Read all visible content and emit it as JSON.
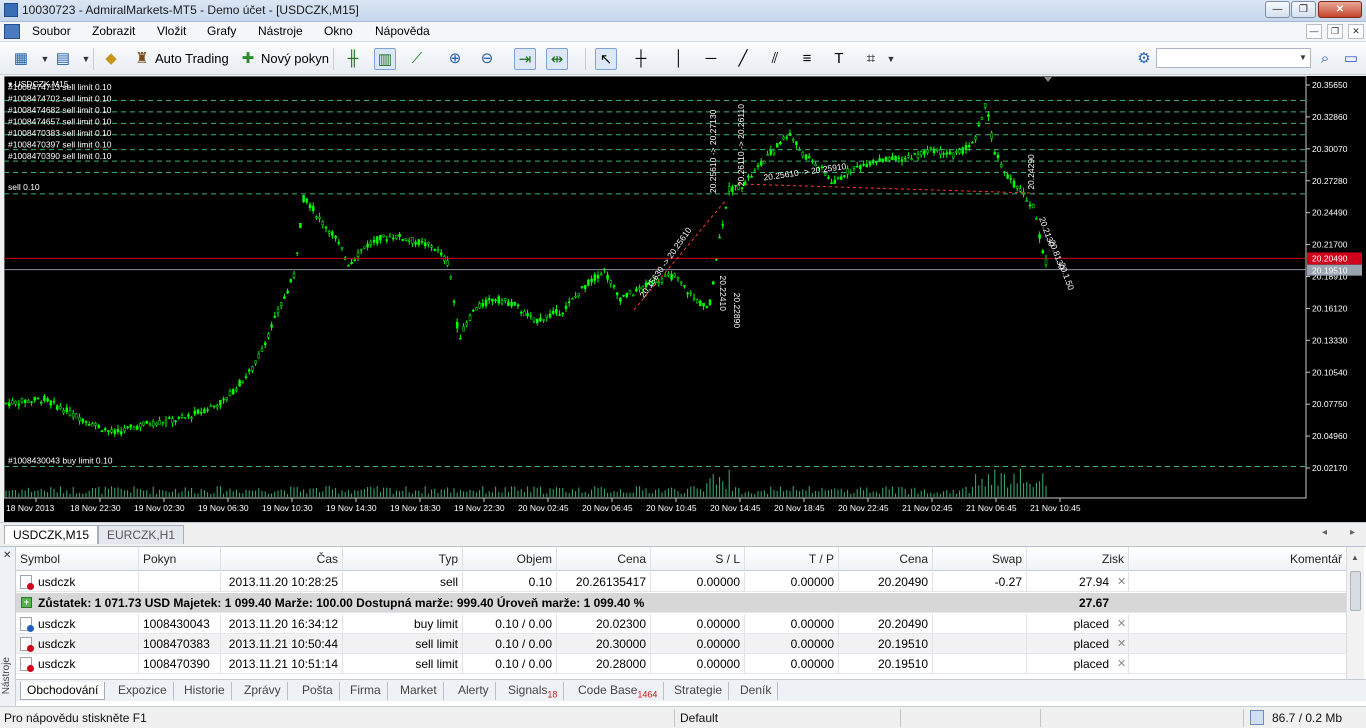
{
  "window": {
    "title": "10030723 - AdmiralMarkets-MT5 - Demo účet - [USDCZK,M15]",
    "min": "—",
    "max": "❐",
    "close": "✕"
  },
  "menu": {
    "items": [
      "Soubor",
      "Zobrazit",
      "Vložit",
      "Grafy",
      "Nástroje",
      "Okno",
      "Nápověda"
    ],
    "mdi_min": "—",
    "mdi_restore": "❐",
    "mdi_close": "✕"
  },
  "toolbar": {
    "auto_trading": "Auto Trading",
    "new_order": "Nový pokyn",
    "search_value": ""
  },
  "chart": {
    "symbol": "USDCZK,M15",
    "price_axis": [
      "20.35650",
      "20.32860",
      "20.30070",
      "20.27280",
      "20.24490",
      "20.21700",
      "20.18910",
      "20.16120",
      "20.13330",
      "20.10540",
      "20.07750",
      "20.04960",
      "20.02170"
    ],
    "time_axis": [
      "18 Nov 2013",
      "18 Nov 22:30",
      "19 Nov 02:30",
      "19 Nov 06:30",
      "19 Nov 10:30",
      "19 Nov 14:30",
      "19 Nov 18:30",
      "19 Nov 22:30",
      "20 Nov 02:45",
      "20 Nov 06:45",
      "20 Nov 10:45",
      "20 Nov 14:45",
      "20 Nov 18:45",
      "20 Nov 22:45",
      "21 Nov 02:45",
      "21 Nov 06:45",
      "21 Nov 10:45"
    ],
    "current_bid": "20.20490",
    "current_ask": "20.19510",
    "bid_color": "#d0021b",
    "ask_color": "#8b95a1",
    "order_lines": [
      {
        "label": "#1008474713 sell limit 0.10"
      },
      {
        "label": "#1008474702 sell limit 0.10"
      },
      {
        "label": "#1008474682 sell limit 0.10"
      },
      {
        "label": "#1008474657 sell limit 0.10"
      },
      {
        "label": "#1008470383 sell limit 0.10"
      },
      {
        "label": "#1008470397 sell limit 0.10"
      },
      {
        "label": "#1008470390 sell limit 0.10"
      },
      {
        "label": "sell 0.10"
      },
      {
        "label": "#1008430043 buy limit 0.10"
      }
    ],
    "annotations": [
      "20.15630 -> 20.25610",
      "20.25610 -> 20.27130",
      "20.22410",
      "20.22890",
      "20.26110 -> 20.26110",
      "20.24290",
      "20.25610 -> 20.25910",
      "20.2130",
      "20.8130",
      "20.1.50"
    ],
    "candle_color": "#00ff00",
    "line_color": "#3cb371"
  },
  "chart_tabs": [
    "USDCZK,M15",
    "EURCZK,H1"
  ],
  "toolbox": {
    "side_label": "Nástroje",
    "columns": [
      "Symbol",
      "Pokyn",
      "Čas",
      "Typ",
      "Objem",
      "Cena",
      "S / L",
      "T / P",
      "Cena",
      "Swap",
      "Zisk",
      "Komentář"
    ],
    "positions": [
      {
        "symbol": "usdczk",
        "order": "",
        "time": "2013.11.20 10:28:25",
        "type": "sell",
        "volume": "0.10",
        "price": "20.26135417",
        "sl": "0.00000",
        "tp": "0.00000",
        "cur": "20.20490",
        "swap": "-0.27",
        "profit": "27.94",
        "comment": ""
      }
    ],
    "balance_line": "Zůstatek: 1 071.73 USD  Majetek: 1 099.40  Marže: 100.00  Dostupná marže: 999.40  Úroveň marže: 1 099.40 %",
    "balance_profit": "27.67",
    "orders": [
      {
        "symbol": "usdczk",
        "order": "1008430043",
        "time": "2013.11.20 16:34:12",
        "type": "buy limit",
        "volume": "0.10 / 0.00",
        "price": "20.02300",
        "sl": "0.00000",
        "tp": "0.00000",
        "cur": "20.20490",
        "swap": "",
        "profit": "placed",
        "comment": ""
      },
      {
        "symbol": "usdczk",
        "order": "1008470383",
        "time": "2013.11.21 10:50:44",
        "type": "sell limit",
        "volume": "0.10 / 0.00",
        "price": "20.30000",
        "sl": "0.00000",
        "tp": "0.00000",
        "cur": "20.19510",
        "swap": "",
        "profit": "placed",
        "comment": ""
      },
      {
        "symbol": "usdczk",
        "order": "1008470390",
        "time": "2013.11.21 10:51:14",
        "type": "sell limit",
        "volume": "0.10 / 0.00",
        "price": "20.28000",
        "sl": "0.00000",
        "tp": "0.00000",
        "cur": "20.19510",
        "swap": "",
        "profit": "placed",
        "comment": ""
      }
    ],
    "tabs": [
      {
        "label": "Obchodování",
        "badge": ""
      },
      {
        "label": "Expozice",
        "badge": ""
      },
      {
        "label": "Historie",
        "badge": ""
      },
      {
        "label": "Zprávy",
        "badge": ""
      },
      {
        "label": "Pošta",
        "badge": ""
      },
      {
        "label": "Firma",
        "badge": ""
      },
      {
        "label": "Market",
        "badge": ""
      },
      {
        "label": "Alerty",
        "badge": ""
      },
      {
        "label": "Signals",
        "badge": "18"
      },
      {
        "label": "Code Base",
        "badge": "1464"
      },
      {
        "label": "Strategie",
        "badge": ""
      },
      {
        "label": "Deník",
        "badge": ""
      }
    ]
  },
  "status": {
    "help": "Pro nápovědu stiskněte F1",
    "profile": "Default",
    "traffic": "86.7 / 0.2 Mb"
  }
}
